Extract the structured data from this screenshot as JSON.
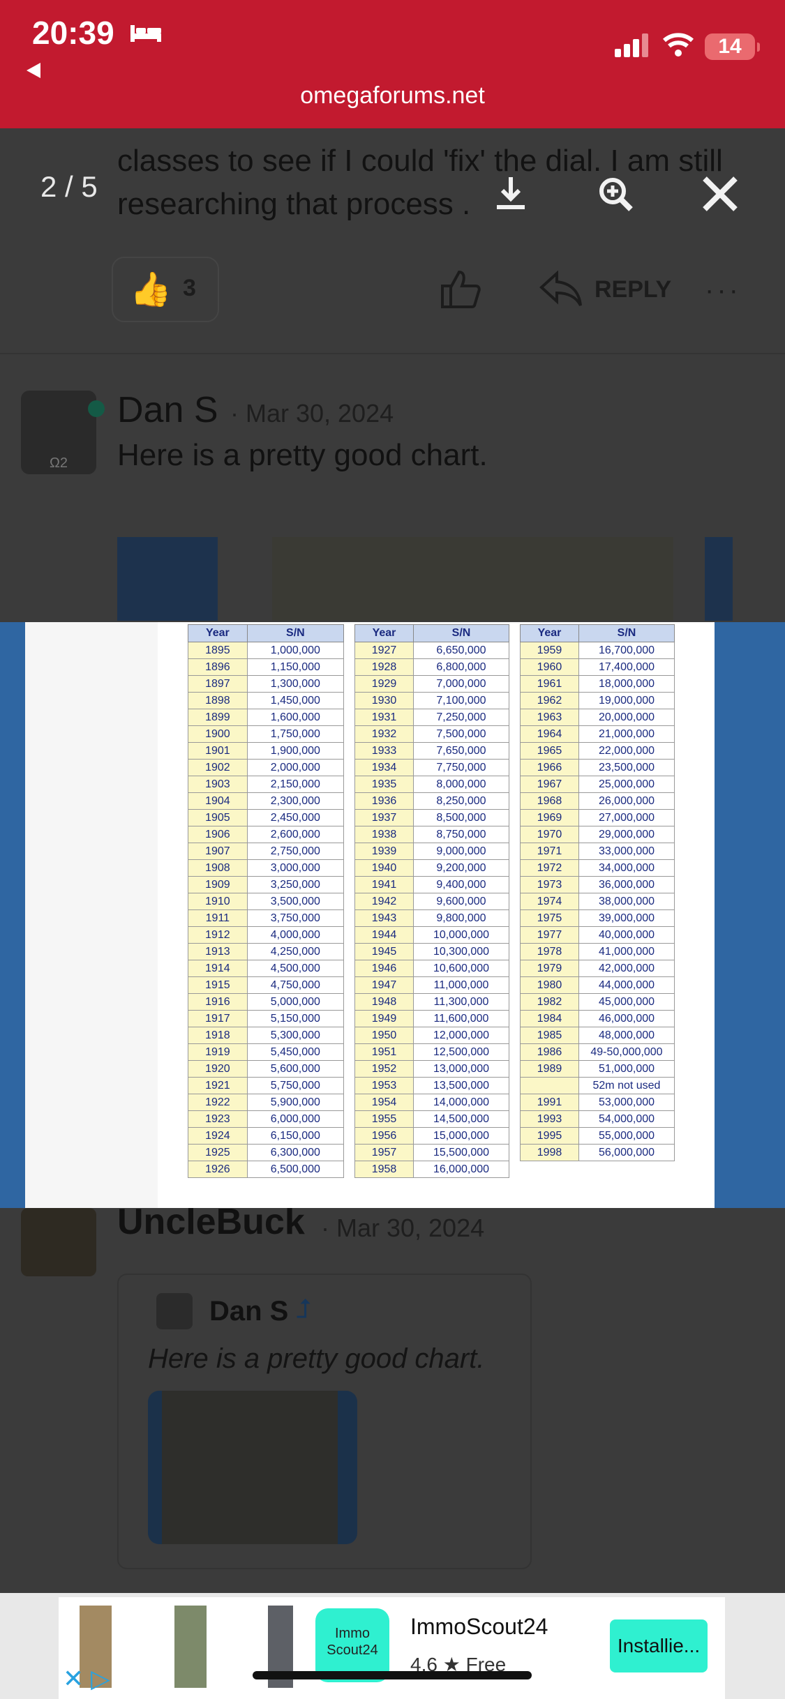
{
  "status": {
    "time": "20:39",
    "battery": "14",
    "url": "omegaforums.net"
  },
  "viewer": {
    "counter": "2 / 5"
  },
  "post1": {
    "text_lines": [
      "classes to see if I could 'fix' the dial. I am still",
      "researching that process ."
    ],
    "likes": "3",
    "reply_label": "REPLY",
    "more": "···"
  },
  "post2": {
    "username": "Dan S",
    "date": "· Mar 30, 2024",
    "avatar_label": "Ω2",
    "body": "Here is a pretty good chart."
  },
  "chart": {
    "headers": [
      "Year",
      "S/N"
    ],
    "col1": [
      [
        "1895",
        "1,000,000"
      ],
      [
        "1896",
        "1,150,000"
      ],
      [
        "1897",
        "1,300,000"
      ],
      [
        "1898",
        "1,450,000"
      ],
      [
        "1899",
        "1,600,000"
      ],
      [
        "1900",
        "1,750,000"
      ],
      [
        "1901",
        "1,900,000"
      ],
      [
        "1902",
        "2,000,000"
      ],
      [
        "1903",
        "2,150,000"
      ],
      [
        "1904",
        "2,300,000"
      ],
      [
        "1905",
        "2,450,000"
      ],
      [
        "1906",
        "2,600,000"
      ],
      [
        "1907",
        "2,750,000"
      ],
      [
        "1908",
        "3,000,000"
      ],
      [
        "1909",
        "3,250,000"
      ],
      [
        "1910",
        "3,500,000"
      ],
      [
        "1911",
        "3,750,000"
      ],
      [
        "1912",
        "4,000,000"
      ],
      [
        "1913",
        "4,250,000"
      ],
      [
        "1914",
        "4,500,000"
      ],
      [
        "1915",
        "4,750,000"
      ],
      [
        "1916",
        "5,000,000"
      ],
      [
        "1917",
        "5,150,000"
      ],
      [
        "1918",
        "5,300,000"
      ],
      [
        "1919",
        "5,450,000"
      ],
      [
        "1920",
        "5,600,000"
      ],
      [
        "1921",
        "5,750,000"
      ],
      [
        "1922",
        "5,900,000"
      ],
      [
        "1923",
        "6,000,000"
      ],
      [
        "1924",
        "6,150,000"
      ],
      [
        "1925",
        "6,300,000"
      ],
      [
        "1926",
        "6,500,000"
      ]
    ],
    "col2": [
      [
        "1927",
        "6,650,000"
      ],
      [
        "1928",
        "6,800,000"
      ],
      [
        "1929",
        "7,000,000"
      ],
      [
        "1930",
        "7,100,000"
      ],
      [
        "1931",
        "7,250,000"
      ],
      [
        "1932",
        "7,500,000"
      ],
      [
        "1933",
        "7,650,000"
      ],
      [
        "1934",
        "7,750,000"
      ],
      [
        "1935",
        "8,000,000"
      ],
      [
        "1936",
        "8,250,000"
      ],
      [
        "1937",
        "8,500,000"
      ],
      [
        "1938",
        "8,750,000"
      ],
      [
        "1939",
        "9,000,000"
      ],
      [
        "1940",
        "9,200,000"
      ],
      [
        "1941",
        "9,400,000"
      ],
      [
        "1942",
        "9,600,000"
      ],
      [
        "1943",
        "9,800,000"
      ],
      [
        "1944",
        "10,000,000"
      ],
      [
        "1945",
        "10,300,000"
      ],
      [
        "1946",
        "10,600,000"
      ],
      [
        "1947",
        "11,000,000"
      ],
      [
        "1948",
        "11,300,000"
      ],
      [
        "1949",
        "11,600,000"
      ],
      [
        "1950",
        "12,000,000"
      ],
      [
        "1951",
        "12,500,000"
      ],
      [
        "1952",
        "13,000,000"
      ],
      [
        "1953",
        "13,500,000"
      ],
      [
        "1954",
        "14,000,000"
      ],
      [
        "1955",
        "14,500,000"
      ],
      [
        "1956",
        "15,000,000"
      ],
      [
        "1957",
        "15,500,000"
      ],
      [
        "1958",
        "16,000,000"
      ]
    ],
    "col3": [
      [
        "1959",
        "16,700,000"
      ],
      [
        "1960",
        "17,400,000"
      ],
      [
        "1961",
        "18,000,000"
      ],
      [
        "1962",
        "19,000,000"
      ],
      [
        "1963",
        "20,000,000"
      ],
      [
        "1964",
        "21,000,000"
      ],
      [
        "1965",
        "22,000,000"
      ],
      [
        "1966",
        "23,500,000"
      ],
      [
        "1967",
        "25,000,000"
      ],
      [
        "1968",
        "26,000,000"
      ],
      [
        "1969",
        "27,000,000"
      ],
      [
        "1970",
        "29,000,000"
      ],
      [
        "1971",
        "33,000,000"
      ],
      [
        "1972",
        "34,000,000"
      ],
      [
        "1973",
        "36,000,000"
      ],
      [
        "1974",
        "38,000,000"
      ],
      [
        "1975",
        "39,000,000"
      ],
      [
        "1977",
        "40,000,000"
      ],
      [
        "1978",
        "41,000,000"
      ],
      [
        "1979",
        "42,000,000"
      ],
      [
        "1980",
        "44,000,000"
      ],
      [
        "1982",
        "45,000,000"
      ],
      [
        "1984",
        "46,000,000"
      ],
      [
        "1985",
        "48,000,000"
      ],
      [
        "1986",
        "49-50,000,000"
      ],
      [
        "1989",
        "51,000,000"
      ],
      [
        "",
        "52m not used"
      ],
      [
        "1991",
        "53,000,000"
      ],
      [
        "1993",
        "54,000,000"
      ],
      [
        "1995",
        "55,000,000"
      ],
      [
        "1998",
        "56,000,000"
      ]
    ]
  },
  "post3": {
    "username": "UncleBuck",
    "date": "· Mar 30, 2024",
    "quote_user": "Dan S",
    "quote_arrow": "⮥",
    "quote_text": "Here is a pretty good chart."
  },
  "ad": {
    "logo_line1": "Immo",
    "logo_line2": "Scout24",
    "title": "ImmoScout24",
    "rating": "4.6 ★  Free",
    "install": "Installie..."
  },
  "colors": {
    "header_red": "#c21a2f",
    "image_blue": "#2f66a2",
    "ad_teal": "#2ff0d0"
  }
}
